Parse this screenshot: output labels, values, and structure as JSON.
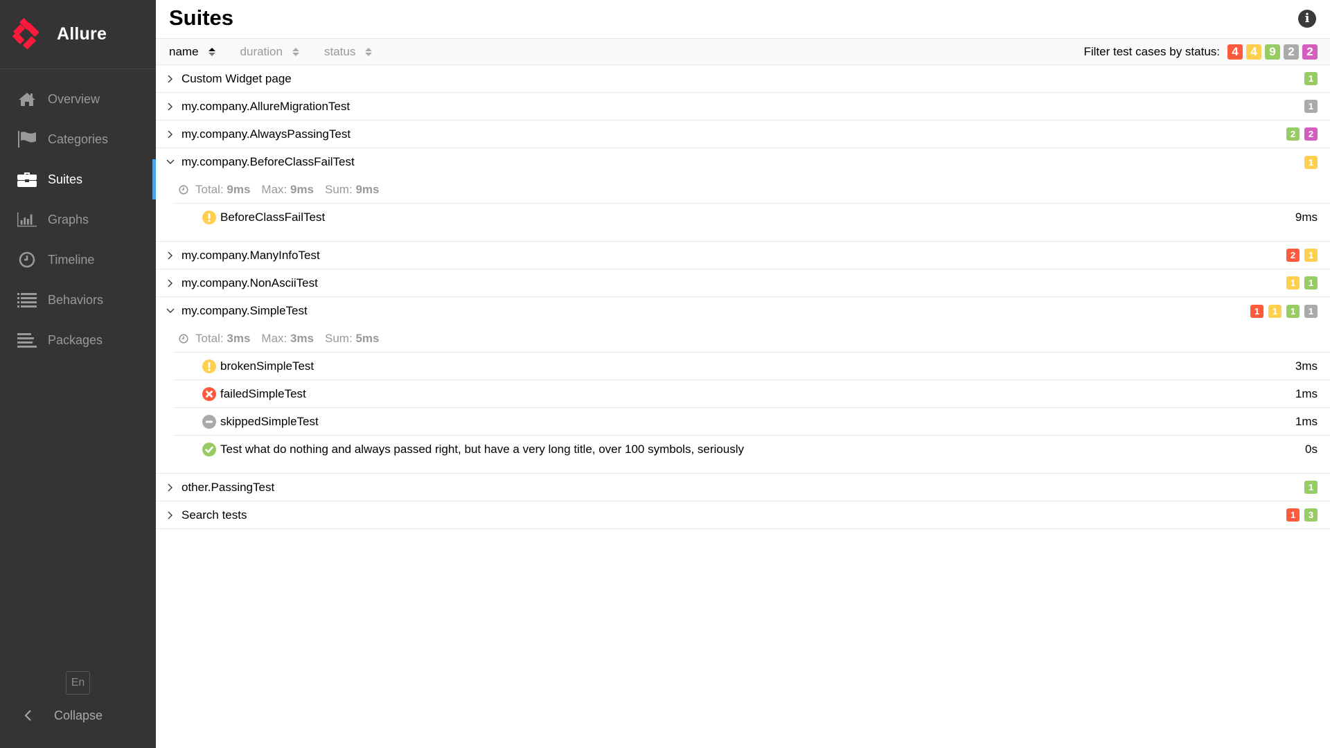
{
  "app": {
    "name": "Allure"
  },
  "sidebar": {
    "items": [
      {
        "label": "Overview",
        "icon": "home-icon",
        "active": false
      },
      {
        "label": "Categories",
        "icon": "flag-icon",
        "active": false
      },
      {
        "label": "Suites",
        "icon": "briefcase-icon",
        "active": true
      },
      {
        "label": "Graphs",
        "icon": "bar-chart-icon",
        "active": false
      },
      {
        "label": "Timeline",
        "icon": "clock-icon",
        "active": false
      },
      {
        "label": "Behaviors",
        "icon": "list-icon",
        "active": false
      },
      {
        "label": "Packages",
        "icon": "align-left-icon",
        "active": false
      }
    ],
    "language": "En",
    "collapse_label": "Collapse"
  },
  "header": {
    "title": "Suites",
    "info_icon": "info-icon"
  },
  "sort_bar": {
    "columns": [
      {
        "label": "name",
        "active": true
      },
      {
        "label": "duration",
        "active": false
      },
      {
        "label": "status",
        "active": false
      }
    ],
    "filter_label": "Filter test cases by status:",
    "filters": [
      {
        "status": "failed",
        "count": "4",
        "color": "#fd5a3e"
      },
      {
        "status": "broken",
        "count": "4",
        "color": "#ffd050"
      },
      {
        "status": "passed",
        "count": "9",
        "color": "#97cc64"
      },
      {
        "status": "skipped",
        "count": "2",
        "color": "#aaaaaa"
      },
      {
        "status": "unknown",
        "count": "2",
        "color": "#d35ebe"
      }
    ]
  },
  "suites": [
    {
      "name": "Custom Widget page",
      "expanded": false,
      "badges": [
        {
          "status": "passed",
          "count": "1"
        }
      ]
    },
    {
      "name": "my.company.AllureMigrationTest",
      "expanded": false,
      "badges": [
        {
          "status": "skipped",
          "count": "1"
        }
      ]
    },
    {
      "name": "my.company.AlwaysPassingTest",
      "expanded": false,
      "badges": [
        {
          "status": "passed",
          "count": "2"
        },
        {
          "status": "unknown",
          "count": "2"
        }
      ]
    },
    {
      "name": "my.company.BeforeClassFailTest",
      "expanded": true,
      "badges": [
        {
          "status": "broken",
          "count": "1"
        }
      ],
      "stats": {
        "total_label": "Total:",
        "total": "9ms",
        "max_label": "Max:",
        "max": "9ms",
        "sum_label": "Sum:",
        "sum": "9ms"
      },
      "tests": [
        {
          "name": "BeforeClassFailTest",
          "status": "broken",
          "duration": "9ms"
        }
      ]
    },
    {
      "name": "my.company.ManyInfoTest",
      "expanded": false,
      "badges": [
        {
          "status": "failed",
          "count": "2"
        },
        {
          "status": "broken",
          "count": "1"
        }
      ]
    },
    {
      "name": "my.company.NonAsciiTest",
      "expanded": false,
      "badges": [
        {
          "status": "broken",
          "count": "1"
        },
        {
          "status": "passed",
          "count": "1"
        }
      ]
    },
    {
      "name": "my.company.SimpleTest",
      "expanded": true,
      "badges": [
        {
          "status": "failed",
          "count": "1"
        },
        {
          "status": "broken",
          "count": "1"
        },
        {
          "status": "passed",
          "count": "1"
        },
        {
          "status": "skipped",
          "count": "1"
        }
      ],
      "stats": {
        "total_label": "Total:",
        "total": "3ms",
        "max_label": "Max:",
        "max": "3ms",
        "sum_label": "Sum:",
        "sum": "5ms"
      },
      "tests": [
        {
          "name": "brokenSimpleTest",
          "status": "broken",
          "duration": "3ms"
        },
        {
          "name": "failedSimpleTest",
          "status": "failed",
          "duration": "1ms"
        },
        {
          "name": "skippedSimpleTest",
          "status": "skipped",
          "duration": "1ms"
        },
        {
          "name": "Test what do nothing and always passed right, but have a very long title, over 100 symbols, seriously",
          "status": "passed",
          "duration": "0s"
        }
      ]
    },
    {
      "name": "other.PassingTest",
      "expanded": false,
      "badges": [
        {
          "status": "passed",
          "count": "1"
        }
      ]
    },
    {
      "name": "Search tests",
      "expanded": false,
      "badges": [
        {
          "status": "failed",
          "count": "1"
        },
        {
          "status": "passed",
          "count": "3"
        }
      ]
    }
  ]
}
